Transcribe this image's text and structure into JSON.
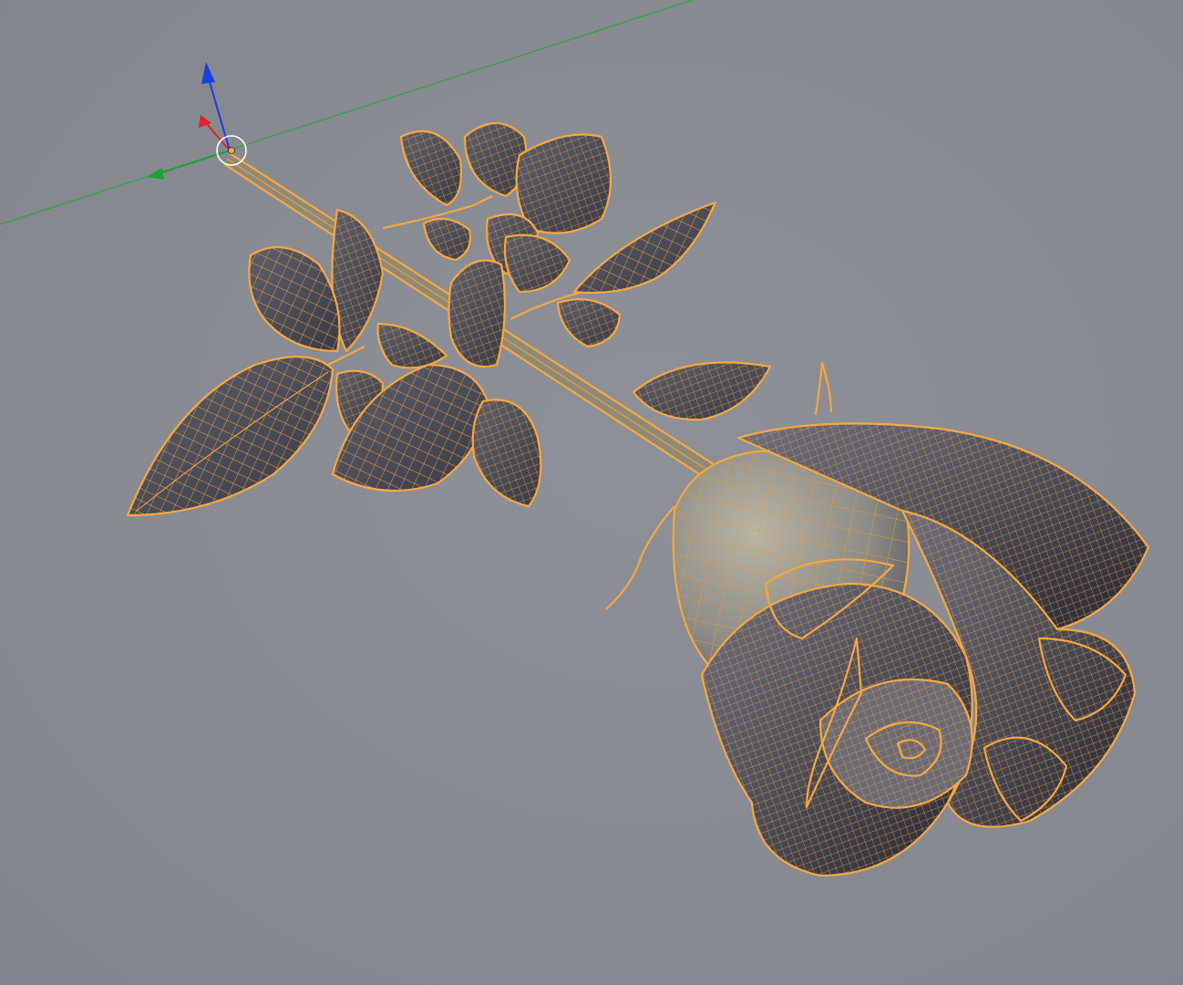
{
  "viewport": {
    "mode": "3d-viewport",
    "shading": "solid-with-wireframe-overlay",
    "selection_color": "#f5a640",
    "background_color": "#8a8c94"
  },
  "object": {
    "type": "rose-mesh",
    "selected": true
  },
  "gizmo": {
    "axes": [
      {
        "name": "z",
        "color": "#1a3fe0",
        "icon": "arrow-up-icon"
      },
      {
        "name": "x",
        "color": "#e0202a",
        "icon": "arrow-icon"
      },
      {
        "name": "y",
        "color": "#1fa33a",
        "icon": "arrow-left-icon"
      }
    ],
    "pivot_icon": "origin-circle-icon"
  }
}
